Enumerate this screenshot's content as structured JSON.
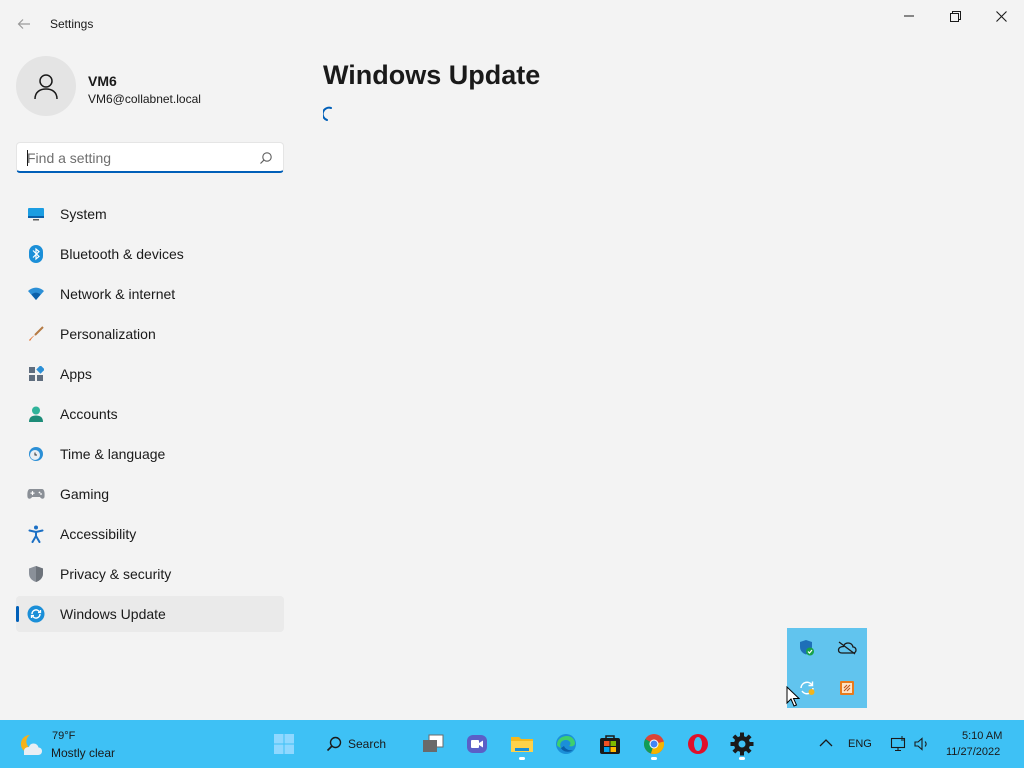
{
  "window": {
    "title": "Settings",
    "back_icon": "back-arrow-icon",
    "controls": [
      "minimize-icon",
      "restore-icon",
      "close-icon"
    ]
  },
  "profile": {
    "name": "VM6",
    "email": "VM6@collabnet.local"
  },
  "search": {
    "placeholder": "Find a setting",
    "value": ""
  },
  "sidebar": {
    "items": [
      {
        "label": "System",
        "icon": "system-icon",
        "active": false
      },
      {
        "label": "Bluetooth & devices",
        "icon": "bluetooth-icon",
        "active": false
      },
      {
        "label": "Network & internet",
        "icon": "network-icon",
        "active": false
      },
      {
        "label": "Personalization",
        "icon": "personalization-brush-icon",
        "active": false
      },
      {
        "label": "Apps",
        "icon": "apps-icon",
        "active": false
      },
      {
        "label": "Accounts",
        "icon": "accounts-icon",
        "active": false
      },
      {
        "label": "Time & language",
        "icon": "time-language-icon",
        "active": false
      },
      {
        "label": "Gaming",
        "icon": "gaming-icon",
        "active": false
      },
      {
        "label": "Accessibility",
        "icon": "accessibility-icon",
        "active": false
      },
      {
        "label": "Privacy & security",
        "icon": "shield-icon",
        "active": false
      },
      {
        "label": "Windows Update",
        "icon": "windows-update-icon",
        "active": true
      }
    ]
  },
  "main": {
    "title": "Windows Update",
    "loading": true
  },
  "tray_flyout": {
    "icons": [
      "windows-security-icon",
      "onedrive-offline-icon",
      "sync-icon",
      "sticky-app-icon"
    ]
  },
  "taskbar": {
    "weather": {
      "temp": "79°F",
      "condition": "Mostly clear"
    },
    "search_label": "Search",
    "apps": [
      "start-icon",
      "search-icon",
      "task-view-icon",
      "teams-icon",
      "file-explorer-icon",
      "edge-icon",
      "store-icon",
      "chrome-icon",
      "opera-icon",
      "settings-gear-icon"
    ],
    "language": "ENG",
    "time": "5:10 AM",
    "date": "11/27/2022"
  },
  "colors": {
    "accent": "#005fb8",
    "taskbar": "#3ec1f5",
    "flyout": "#61c4ee",
    "background": "#f3f3f3"
  }
}
